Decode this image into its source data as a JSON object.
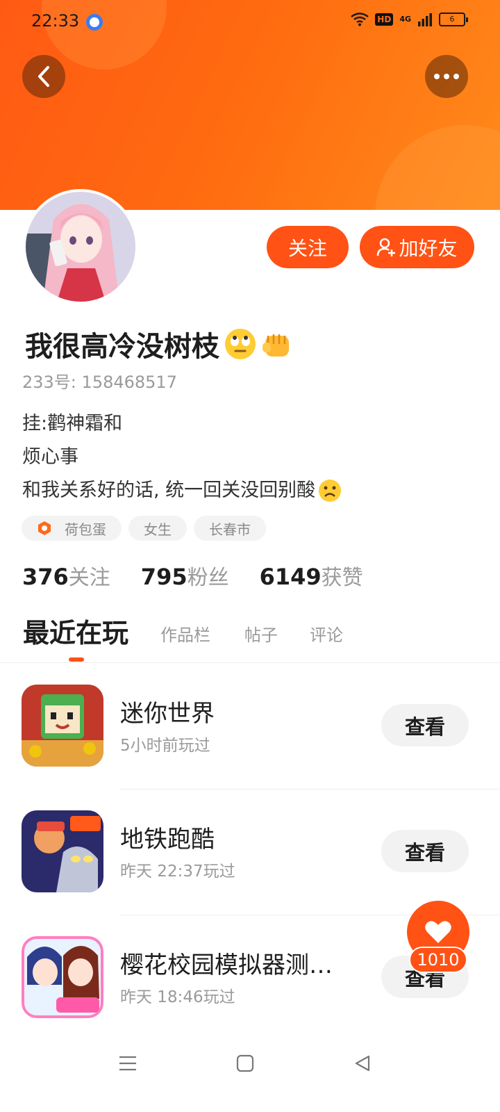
{
  "status_bar": {
    "time": "22:33",
    "hd": "HD",
    "network": "4G",
    "battery": "6",
    "icons": [
      "browser-app-icon",
      "wifi-icon",
      "hd-icon",
      "signal-icon",
      "battery-icon"
    ]
  },
  "header": {
    "back_icon": "chevron-left-icon",
    "more_icon": "more-dots-icon",
    "colors": {
      "start": "#ff5a14",
      "end": "#ff8a1a"
    }
  },
  "profile": {
    "follow_label": "关注",
    "add_friend_label": "加好友",
    "name": "我很高冷没树枝",
    "uid_label": "233号:",
    "uid": "158468517",
    "bio": [
      "挂:鹳神霜和",
      "烦心事",
      "和我关系好的话, 统一回关没回别酸"
    ],
    "tags": [
      {
        "icon": "hexagon-badge-icon",
        "label": "荷包蛋"
      },
      {
        "label": "女生"
      },
      {
        "label": "长春市"
      }
    ],
    "stats": [
      {
        "num": "376",
        "label": "关注"
      },
      {
        "num": "795",
        "label": "粉丝"
      },
      {
        "num": "6149",
        "label": "获赞"
      }
    ]
  },
  "tabs": [
    {
      "label": "最近在玩",
      "active": true
    },
    {
      "label": "作品栏"
    },
    {
      "label": "帖子"
    },
    {
      "label": "评论"
    }
  ],
  "games": [
    {
      "name": "迷你世界",
      "time": "5小时前玩过",
      "button": "查看"
    },
    {
      "name": "地铁跑酷",
      "time": "昨天 22:37玩过",
      "button": "查看"
    },
    {
      "name": "樱花校园模拟器测…",
      "time": "昨天 18:46玩过",
      "button": "查看"
    }
  ],
  "like": {
    "count": "1010",
    "icon": "heart-icon"
  },
  "navbar": {
    "icons": [
      "menu-icon",
      "home-square-icon",
      "back-triangle-icon"
    ]
  },
  "accent_color": "#ff5214"
}
